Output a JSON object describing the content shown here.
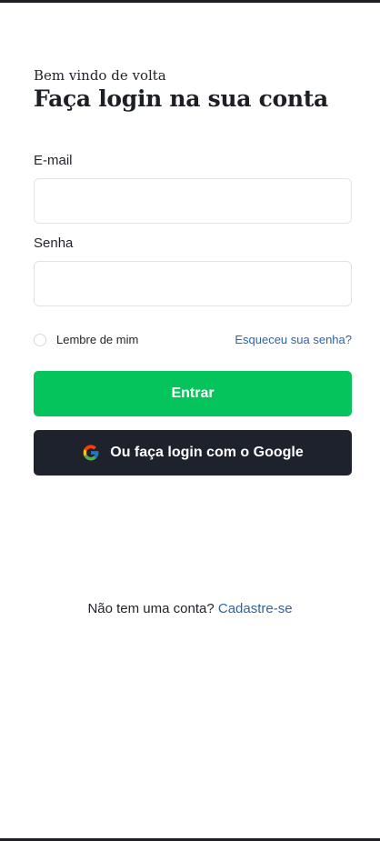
{
  "header": {
    "greeting": "Bem vindo de volta",
    "title": "Faça login na sua conta"
  },
  "form": {
    "email_label": "E-mail",
    "email_value": "",
    "email_placeholder": "",
    "password_label": "Senha",
    "password_value": "",
    "password_placeholder": "",
    "remember_label": "Lembre de mim",
    "remember_checked": false,
    "forgot_link": "Esqueceu sua senha?",
    "submit_label": "Entrar",
    "google_label": "Ou faça login com o Google"
  },
  "footer": {
    "prompt": "Não tem uma conta?",
    "signup_link": "Cadastre-se"
  },
  "colors": {
    "primary_button": "#06c45c",
    "google_button": "#1e222c",
    "link": "#2d64a8"
  },
  "icons": {
    "google": "google-g-icon"
  }
}
